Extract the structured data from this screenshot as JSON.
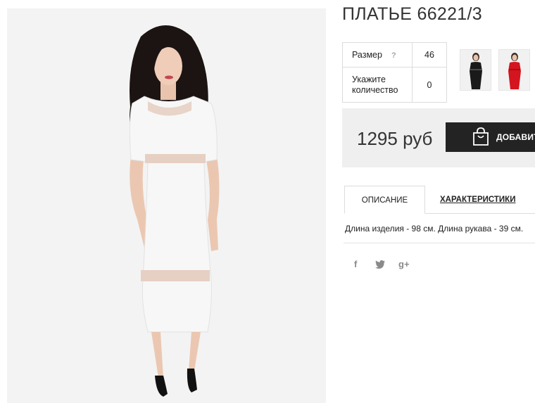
{
  "product": {
    "title": "ПЛАТЬЕ 66221/3",
    "image_alt": "white-dress-model-photo"
  },
  "options": {
    "size_label": "Размер",
    "size_help": "?",
    "size_value": "46",
    "quantity_label_line1": "Укажите",
    "quantity_label_line2": "количество",
    "quantity_value": "0"
  },
  "thumbnails": [
    {
      "name": "black-dress-thumbnail",
      "color": "#1a1a1a"
    },
    {
      "name": "red-dress-thumbnail",
      "color": "#d4141e"
    }
  ],
  "purchase": {
    "price": "1295 руб",
    "buy_label": "ДОБАВИТЬ"
  },
  "tabs": {
    "description": "ОПИСАНИЕ",
    "characteristics": "ХАРАКТЕРИСТИКИ"
  },
  "description_text": "Длина изделия - 98 см. Длина рукава - 39 см.",
  "social": {
    "facebook": "f",
    "twitter": "twitter-icon",
    "gplus": "g+"
  },
  "colors": {
    "accent_dark": "#232323",
    "price_box": "#efefef",
    "dress_white": "#f7f7f7",
    "hair": "#1c1412"
  }
}
